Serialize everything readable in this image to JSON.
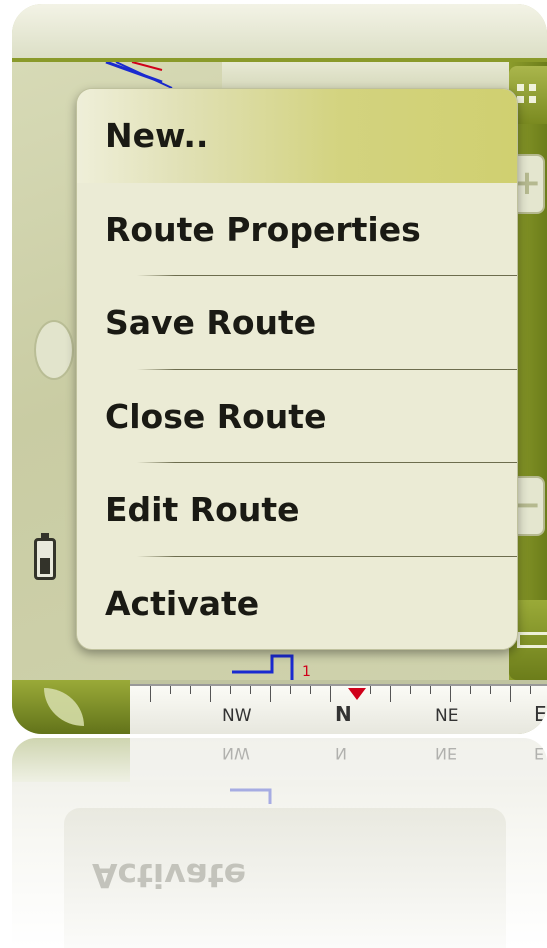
{
  "menu": {
    "items": [
      {
        "label": "New.."
      },
      {
        "label": "Route Properties"
      },
      {
        "label": "Save Route"
      },
      {
        "label": "Close Route"
      },
      {
        "label": "Edit Route"
      },
      {
        "label": "Activate"
      }
    ],
    "highlighted_index": 0
  },
  "compass": {
    "labels": [
      "NW",
      "N",
      "NE",
      "E"
    ],
    "pointer_color": "#d0001a"
  },
  "map": {
    "route_marker": "1"
  },
  "colors": {
    "accent_green": "#8a9a2a",
    "menu_bg": "#ebebd5",
    "menu_highlight": "#d3d37f"
  }
}
